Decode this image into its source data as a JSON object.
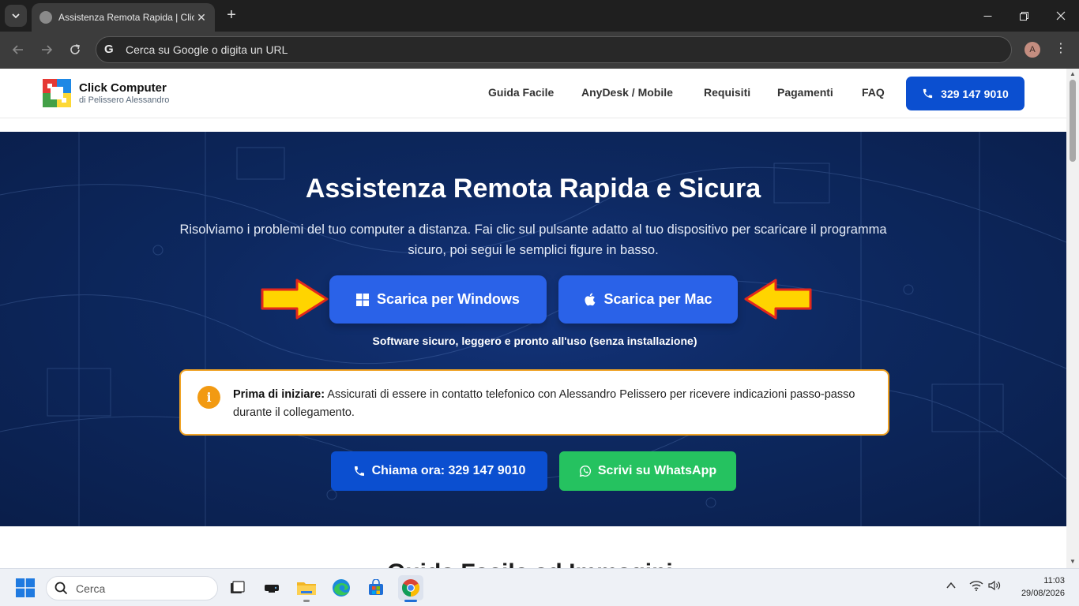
{
  "browser": {
    "tab_title": "Assistenza Remota Rapida | Click",
    "new_tab": "+",
    "omnibox_placeholder": "Cerca su Google o digita un URL",
    "profile_initial": "A"
  },
  "site": {
    "logo_title": "Click Computer",
    "logo_subtitle": "di Pelissero Alessandro",
    "nav": [
      "Guida Facile",
      "AnyDesk / Mobile",
      "Requisiti",
      "Pagamenti",
      "FAQ"
    ],
    "phone_button": "329 147 9010"
  },
  "hero": {
    "title": "Assistenza Remota Rapida e Sicura",
    "subtitle": "Risolviamo i problemi del tuo computer a distanza. Fai clic sul pulsante adatto al tuo dispositivo per scaricare il programma sicuro, poi segui le semplici figure in basso.",
    "windows_button": "Scarica per Windows",
    "mac_button": "Scarica per Mac",
    "note": "Software sicuro, leggero e pronto all'uso (senza installazione)",
    "info_bold": "Prima di iniziare:",
    "info_text": " Assicurati di essere in contatto telefonico con Alessandro Pelissero per ricevere indicazioni passo-passo durante il collegamento.",
    "call_button": "Chiama ora: 329 147 9010",
    "whatsapp_button": "Scrivi su WhatsApp"
  },
  "next_section_heading": "Guida Facile ad Immagini",
  "taskbar": {
    "search_label": "Cerca",
    "time": "11:03",
    "date": "29/08/2026"
  },
  "colors": {
    "primary_blue": "#0b4fd0",
    "download_blue": "#2a62e8",
    "whatsapp_green": "#25c260",
    "info_orange": "#f29a12",
    "arrow_yellow": "#ffd400",
    "arrow_red": "#e3281b"
  }
}
